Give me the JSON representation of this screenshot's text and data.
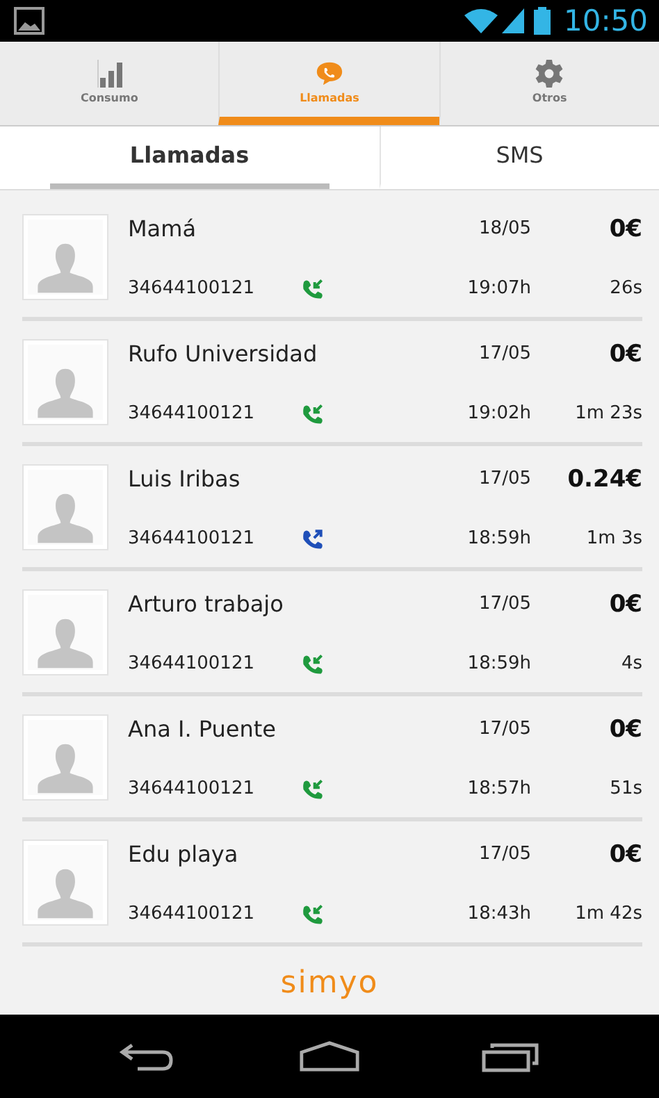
{
  "status_bar": {
    "time": "10:50"
  },
  "tabs": [
    {
      "label": "Consumo",
      "kind": "chart",
      "selected": false
    },
    {
      "label": "Llamadas",
      "kind": "chat",
      "selected": true
    },
    {
      "label": "Otros",
      "kind": "gear",
      "selected": false
    }
  ],
  "subtabs": [
    {
      "label": "Llamadas",
      "selected": true
    },
    {
      "label": "SMS",
      "selected": false
    }
  ],
  "calls": [
    {
      "name": "Mamá",
      "number": "34644100121",
      "kind": "incoming",
      "date": "18/05",
      "time": "19:07h",
      "cost": "0€",
      "duration": "26s"
    },
    {
      "name": "Rufo Universidad",
      "number": "34644100121",
      "kind": "incoming",
      "date": "17/05",
      "time": "19:02h",
      "cost": "0€",
      "duration": "1m 23s"
    },
    {
      "name": "Luis Iribas",
      "number": "34644100121",
      "kind": "outgoing",
      "date": "17/05",
      "time": "18:59h",
      "cost": "0.24€",
      "duration": "1m 3s"
    },
    {
      "name": "Arturo trabajo",
      "number": "34644100121",
      "kind": "incoming",
      "date": "17/05",
      "time": "18:59h",
      "cost": "0€",
      "duration": "4s"
    },
    {
      "name": "Ana I. Puente",
      "number": "34644100121",
      "kind": "incoming",
      "date": "17/05",
      "time": "18:57h",
      "cost": "0€",
      "duration": "51s"
    },
    {
      "name": "Edu playa",
      "number": "34644100121",
      "kind": "incoming",
      "date": "17/05",
      "time": "18:43h",
      "cost": "0€",
      "duration": "1m 42s"
    }
  ],
  "footer": {
    "logo": "simyo"
  }
}
